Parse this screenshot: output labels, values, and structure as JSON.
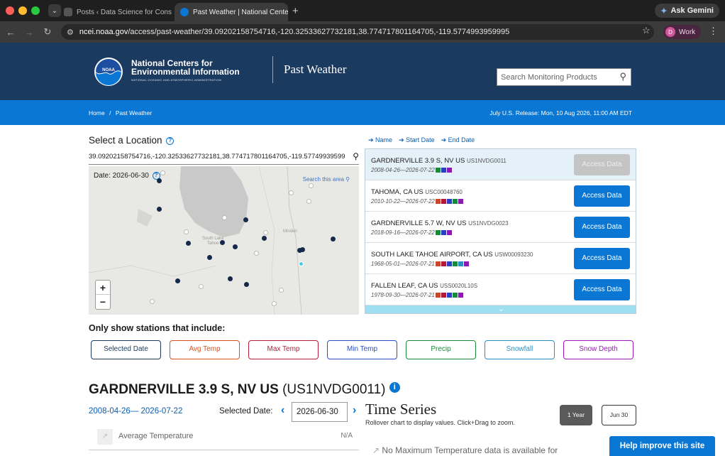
{
  "browser": {
    "tabs": [
      {
        "title": "Posts ‹ Data Science for Cons",
        "active": false
      },
      {
        "title": "Past Weather | National Cente",
        "active": true
      }
    ],
    "gemini_label": "Ask Gemini",
    "url_domain": "ncei.noaa.gov",
    "url_path": "/access/past-weather/39.09202158754716,-120.32533627732181,38.774717801164705,-119.5774993959995",
    "profile_initial": "D",
    "profile_label": "Work"
  },
  "header": {
    "logo_text": "NOAA",
    "org_line1": "National Centers for",
    "org_line2": "Environmental Information",
    "org_line3": "NATIONAL OCEANIC AND ATMOSPHERIC ADMINISTRATION",
    "site_title": "Past Weather",
    "search_placeholder": "Search Monitoring Products"
  },
  "breadcrumb": {
    "home": "Home",
    "sep": "/",
    "current": "Past Weather"
  },
  "release_notice": "July U.S. Release: Mon, 10 Aug 2026, 11:00 AM EDT",
  "location": {
    "heading": "Select a Location",
    "coords": "39.09202158754716,-120.32533627732181,38.774717801164705,-119.57749939599"
  },
  "map": {
    "date_label": "Date: 2026-06-30",
    "search_area": "Search this area",
    "place1": "South Lake",
    "place2": "Tahoe",
    "place3": "Minden",
    "zoom_in": "+",
    "zoom_out": "−"
  },
  "sort": {
    "name": "➔ Name",
    "start": "➔ Start Date",
    "end": "➔ End Date"
  },
  "stations": [
    {
      "name": "GARDNERVILLE 3.9 S, NV US",
      "id": "US1NVDG0011",
      "dates": "2008-04-26—2026-07-22",
      "colors": [
        "#1a8a3a",
        "#2a3fc4",
        "#8a1ab0"
      ],
      "button": "Access Data",
      "disabled": true
    },
    {
      "name": "TAHOMA, CA US",
      "id": "USC00048760",
      "dates": "2010-10-22—2026-07-22",
      "colors": [
        "#c8472b",
        "#b01a3a",
        "#2a3fc4",
        "#1a8a3a",
        "#8a1ab0"
      ],
      "button": "Access Data",
      "disabled": false
    },
    {
      "name": "GARDNERVILLE 5.7 W, NV US",
      "id": "US1NVDG0023",
      "dates": "2018-09-16—2026-07-22",
      "colors": [
        "#1a8a3a",
        "#2a3fc4",
        "#8a1ab0"
      ],
      "button": "Access Data",
      "disabled": false
    },
    {
      "name": "SOUTH LAKE TAHOE AIRPORT, CA US",
      "id": "USW00093230",
      "dates": "1968-05-01—2026-07-21",
      "colors": [
        "#c8472b",
        "#b01a3a",
        "#2a3fc4",
        "#1a8a3a",
        "#2a8fc4",
        "#8a1ab0"
      ],
      "button": "Access Data",
      "disabled": false
    },
    {
      "name": "FALLEN LEAF, CA US",
      "id": "USS0020L10S",
      "dates": "1978-09-30—2026-07-21",
      "colors": [
        "#c8472b",
        "#b01a3a",
        "#2a3fc4",
        "#1a8a3a",
        "#8a1ab0"
      ],
      "button": "Access Data",
      "disabled": false
    }
  ],
  "filters": {
    "heading": "Only show stations that include:",
    "buttons": [
      {
        "label": "Selected Date",
        "color": "#1b3a5f"
      },
      {
        "label": "Avg Temp",
        "color": "#d9501f"
      },
      {
        "label": "Max Temp",
        "color": "#b51d3a"
      },
      {
        "label": "Min Temp",
        "color": "#2a4fc4"
      },
      {
        "label": "Precip",
        "color": "#1a8a3a"
      },
      {
        "label": "Snowfall",
        "color": "#2a8fc4"
      },
      {
        "label": "Snow Depth",
        "color": "#9a1ab8"
      }
    ]
  },
  "station_detail": {
    "name": "GARDNERVILLE 3.9 S, NV US",
    "id": "(US1NVDG0011)",
    "range": "2008-04-26— 2026-07-22",
    "selected_label": "Selected Date:",
    "selected_value": "2026-06-30",
    "avg_label": "Average Temperature",
    "avg_value": "N/A"
  },
  "timeseries": {
    "title": "Time Series",
    "subtitle": "Rollover chart to display values. Click+Drag to zoom.",
    "btn_year": "1 Year",
    "btn_jun": "Jun 30",
    "no_data": "No Maximum Temperature data is available for"
  },
  "feedback_button": "Help improve this site",
  "colors": {
    "header_bg": "#1b3a5f",
    "bluebar": "#0a77d4",
    "accent": "#0a77d4"
  }
}
